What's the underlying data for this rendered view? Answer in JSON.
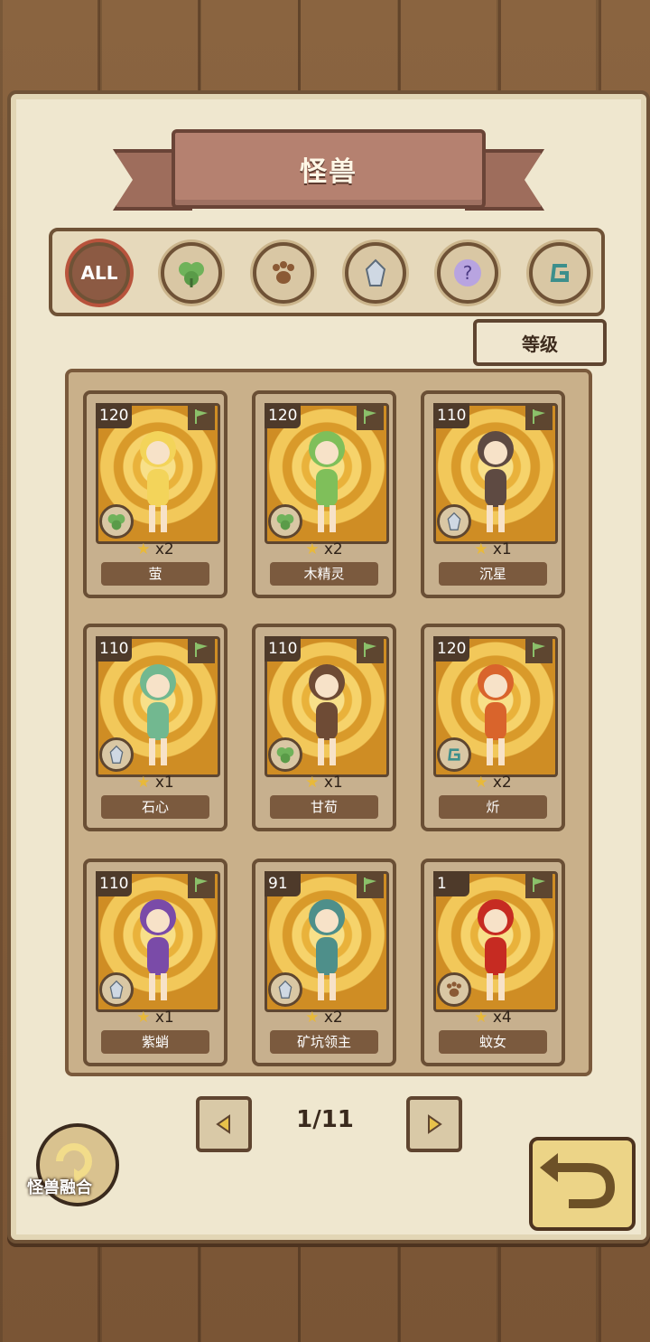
{
  "header": {
    "title": "怪兽"
  },
  "filters": [
    {
      "label": "ALL",
      "icon": "all-icon",
      "active": true
    },
    {
      "label": "",
      "icon": "leaf-clover-icon",
      "active": false
    },
    {
      "label": "",
      "icon": "paw-icon",
      "active": false
    },
    {
      "label": "",
      "icon": "crystal-icon",
      "active": false
    },
    {
      "label": "",
      "icon": "question-mark-icon",
      "active": false
    },
    {
      "label": "",
      "icon": "swirl-rune-icon",
      "active": false
    }
  ],
  "sort": {
    "label": "等级"
  },
  "cards": [
    {
      "level": "120",
      "count": "x2",
      "name": "萤",
      "element": "leaf-clover-icon",
      "color": "#f3d45a"
    },
    {
      "level": "120",
      "count": "x2",
      "name": "木精灵",
      "element": "leaf-clover-icon",
      "color": "#7fbf5a"
    },
    {
      "level": "110",
      "count": "x1",
      "name": "沉星",
      "element": "crystal-icon",
      "color": "#5e4a42"
    },
    {
      "level": "110",
      "count": "x1",
      "name": "石心",
      "element": "crystal-icon",
      "color": "#72b890"
    },
    {
      "level": "110",
      "count": "x1",
      "name": "甘荀",
      "element": "leaf-clover-icon",
      "color": "#6e4b35"
    },
    {
      "level": "120",
      "count": "x2",
      "name": "炘",
      "element": "swirl-rune-icon",
      "color": "#d9642c"
    },
    {
      "level": "110",
      "count": "x1",
      "name": "紫蛸",
      "element": "crystal-icon",
      "color": "#7a4ba8"
    },
    {
      "level": "91",
      "count": "x2",
      "name": "矿坑领主",
      "element": "crystal-icon",
      "color": "#4e8f8a"
    },
    {
      "level": "1",
      "count": "x4",
      "name": "蚊女",
      "element": "paw-icon",
      "color": "#c62b22"
    }
  ],
  "pager": {
    "text": "1/11"
  },
  "fusion": {
    "label": "怪兽融合"
  },
  "colors": {
    "accent": "#8c5a43",
    "card_bg": "#f3c64c",
    "text": "#3a2a1d"
  }
}
